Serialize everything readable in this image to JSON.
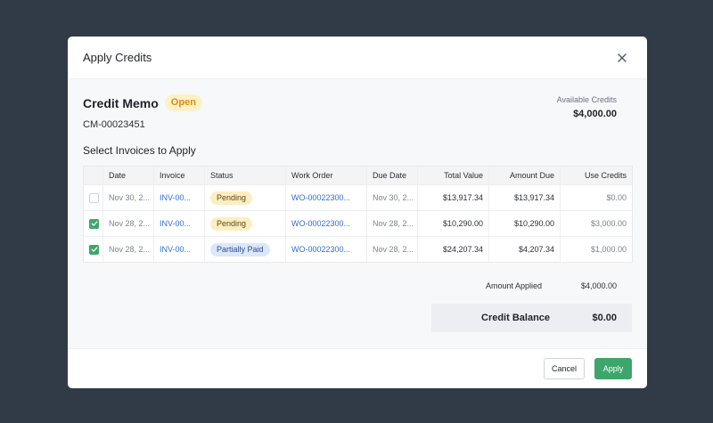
{
  "modal": {
    "title": "Apply Credits"
  },
  "memo": {
    "title": "Credit Memo",
    "status": "Open",
    "number": "CM-00023451",
    "available_label": "Available Credits",
    "available_value": "$4,000.00"
  },
  "invoices": {
    "section_title": "Select Invoices to Apply",
    "columns": [
      "",
      "Date",
      "Invoice",
      "Status",
      "Work Order",
      "Due Date",
      "Total Value",
      "Amount Due",
      "Use Credits"
    ],
    "rows": [
      {
        "checked": false,
        "date": "Nov 30, 2...",
        "invoice": "INV-00...",
        "status": "Pending",
        "work_order": "WO-00022300...",
        "due_date": "Nov 30, 2...",
        "total": "$13,917.34",
        "due": "$13,917.34",
        "credits": "$0.00"
      },
      {
        "checked": true,
        "date": "Nov 28, 2...",
        "invoice": "INV-00...",
        "status": "Pending",
        "work_order": "WO-00022300...",
        "due_date": "Nov 28, 2...",
        "total": "$10,290.00",
        "due": "$10,290.00",
        "credits": "$3,000.00"
      },
      {
        "checked": true,
        "date": "Nov 28, 2...",
        "invoice": "INV-00...",
        "status": "Partially Paid",
        "work_order": "WO-00022300...",
        "due_date": "Nov 28, 2...",
        "total": "$24,207.34",
        "due": "$4,207.34",
        "credits": "$1,000.00"
      }
    ]
  },
  "summary": {
    "applied_label": "Amount Applied",
    "applied_value": "$4,000.00",
    "balance_label": "Credit Balance",
    "balance_value": "$0.00"
  },
  "footer": {
    "cancel_label": "Cancel",
    "apply_label": "Apply"
  },
  "colors": {
    "backdrop": "#313a47",
    "accent": "#3fa66b",
    "link": "#2f6fd8",
    "open_badge": "#fdf1c7",
    "pending_badge": "#fdeec2",
    "partial_badge": "#dbe7fb"
  },
  "icons": {
    "close": "close-icon",
    "check": "check-icon"
  }
}
